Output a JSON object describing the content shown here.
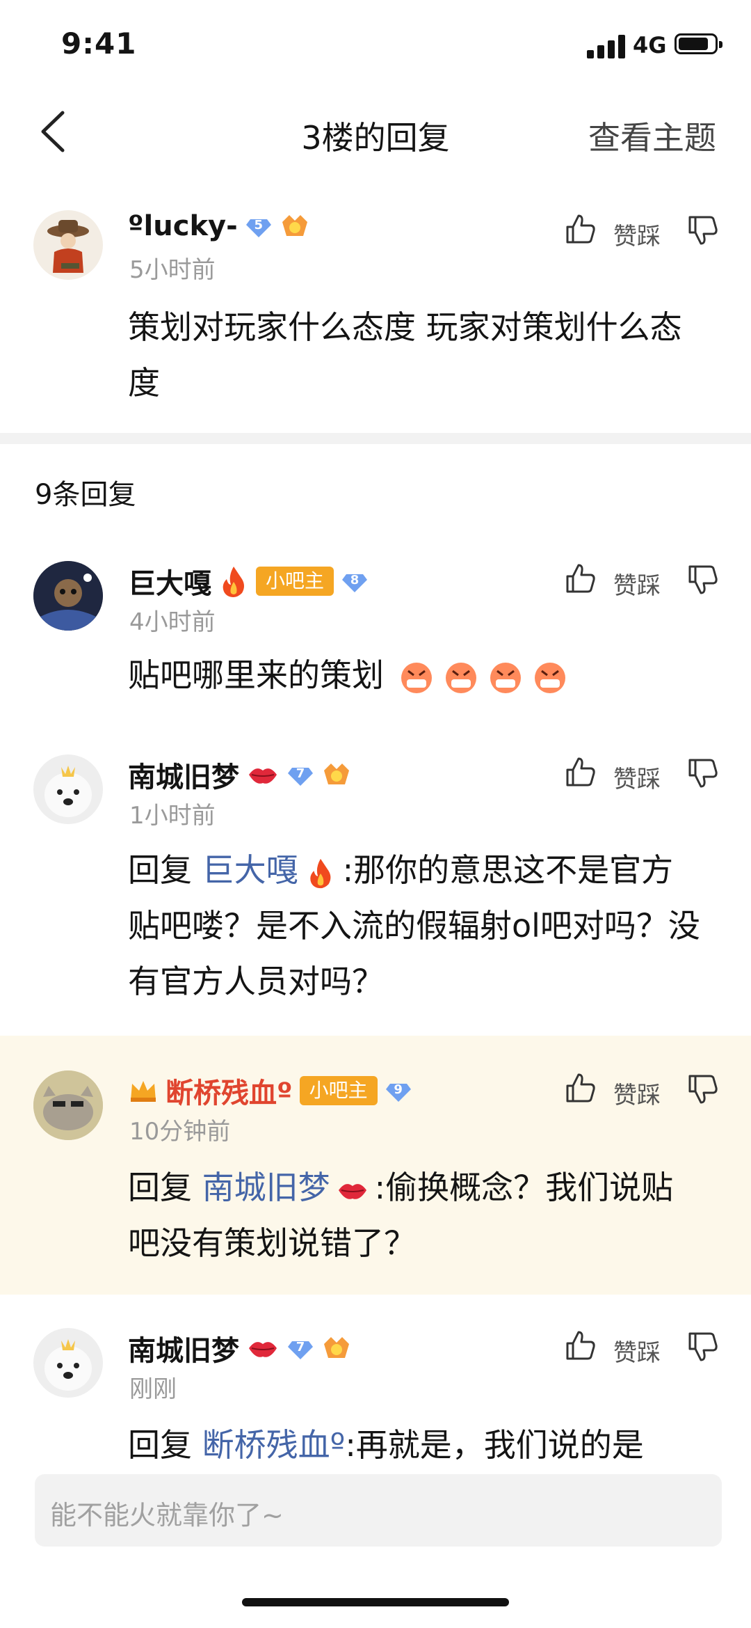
{
  "status": {
    "time": "9:41",
    "network": "4G"
  },
  "nav": {
    "title": "3楼的回复",
    "right_label": "查看主题"
  },
  "post": {
    "username": "ºlucky-",
    "gem_level": "5",
    "time": "5小时前",
    "content": "策划对玩家什么态度 玩家对策划什么态度",
    "action_label": "赞踩"
  },
  "reply_count": "9条回复",
  "replies": [
    {
      "username": "巨大嘎",
      "tag": "小吧主",
      "gem_level": "8",
      "time": "4小时前",
      "content": "贴吧哪里来的策划",
      "action_label": "赞踩"
    },
    {
      "username": "南城旧梦",
      "gem_level": "7",
      "time": "1小时前",
      "reply_prefix": "回复",
      "reply_to": "巨大嘎",
      "content": ":那你的意思这不是官方贴吧喽？是不入流的假辐射ol吧对吗？没有官方人员对吗？",
      "action_label": "赞踩"
    },
    {
      "username": "断桥残血º",
      "tag": "小吧主",
      "gem_level": "9",
      "time": "10分钟前",
      "reply_prefix": "回复",
      "reply_to": "南城旧梦",
      "content": ":偷换概念？我们说贴吧没有策划说错了？",
      "action_label": "赞踩"
    },
    {
      "username": "南城旧梦",
      "gem_level": "7",
      "time": "刚刚",
      "reply_prefix": "回复",
      "reply_to": "断桥残血º",
      "content": ":再就是，我们说的是",
      "action_label": "赞踩"
    }
  ],
  "input": {
    "placeholder": "能不能火就靠你了~"
  },
  "colors": {
    "link": "#4465a8",
    "tag": "#f5a623",
    "gem": "#6fa0f0",
    "highlight": "#fdf8ea",
    "admin_name": "#e0452f"
  }
}
